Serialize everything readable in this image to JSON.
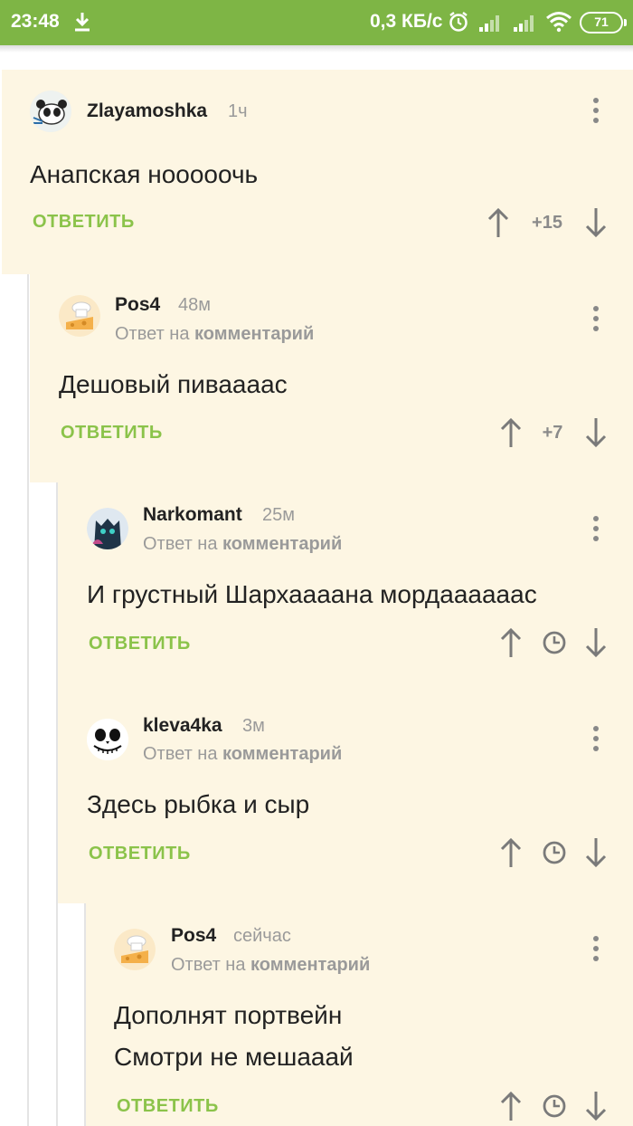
{
  "status_bar": {
    "time": "23:48",
    "speed": "0,3 КБ/с",
    "battery": "71",
    "bg_color": "#7eb545"
  },
  "thread": {
    "reply_label": "ОТВЕТИТЬ",
    "reply_to_prefix": "Ответ на",
    "reply_to_link": "комментарий",
    "accent_color": "#8bc34a",
    "background_color": "#fdf6e3",
    "comments": [
      {
        "author": "Zlayamoshka",
        "time": "1ч",
        "lines": [
          "Анапская нооооочь"
        ],
        "score": "+15",
        "avatar_icon": "panda-avatar-icon"
      },
      {
        "author": "Pos4",
        "time": "48м",
        "lines": [
          "Дешовый пиваааас"
        ],
        "score": "+7",
        "avatar_icon": "cheese-avatar-icon"
      },
      {
        "author": "Narkomant",
        "time": "25м",
        "lines": [
          "И грустный Шархаааана мордаааааас"
        ],
        "avatar_icon": "cat-avatar-icon"
      },
      {
        "author": "kleva4ka",
        "time": "3м",
        "lines": [
          "Здесь рыбка и сыр"
        ],
        "avatar_icon": "skull-avatar-icon"
      },
      {
        "author": "Pos4",
        "time": "сейчас",
        "lines": [
          "Дополнят портвейн",
          "Смотри не мешааай"
        ],
        "avatar_icon": "cheese-avatar-icon"
      }
    ]
  }
}
